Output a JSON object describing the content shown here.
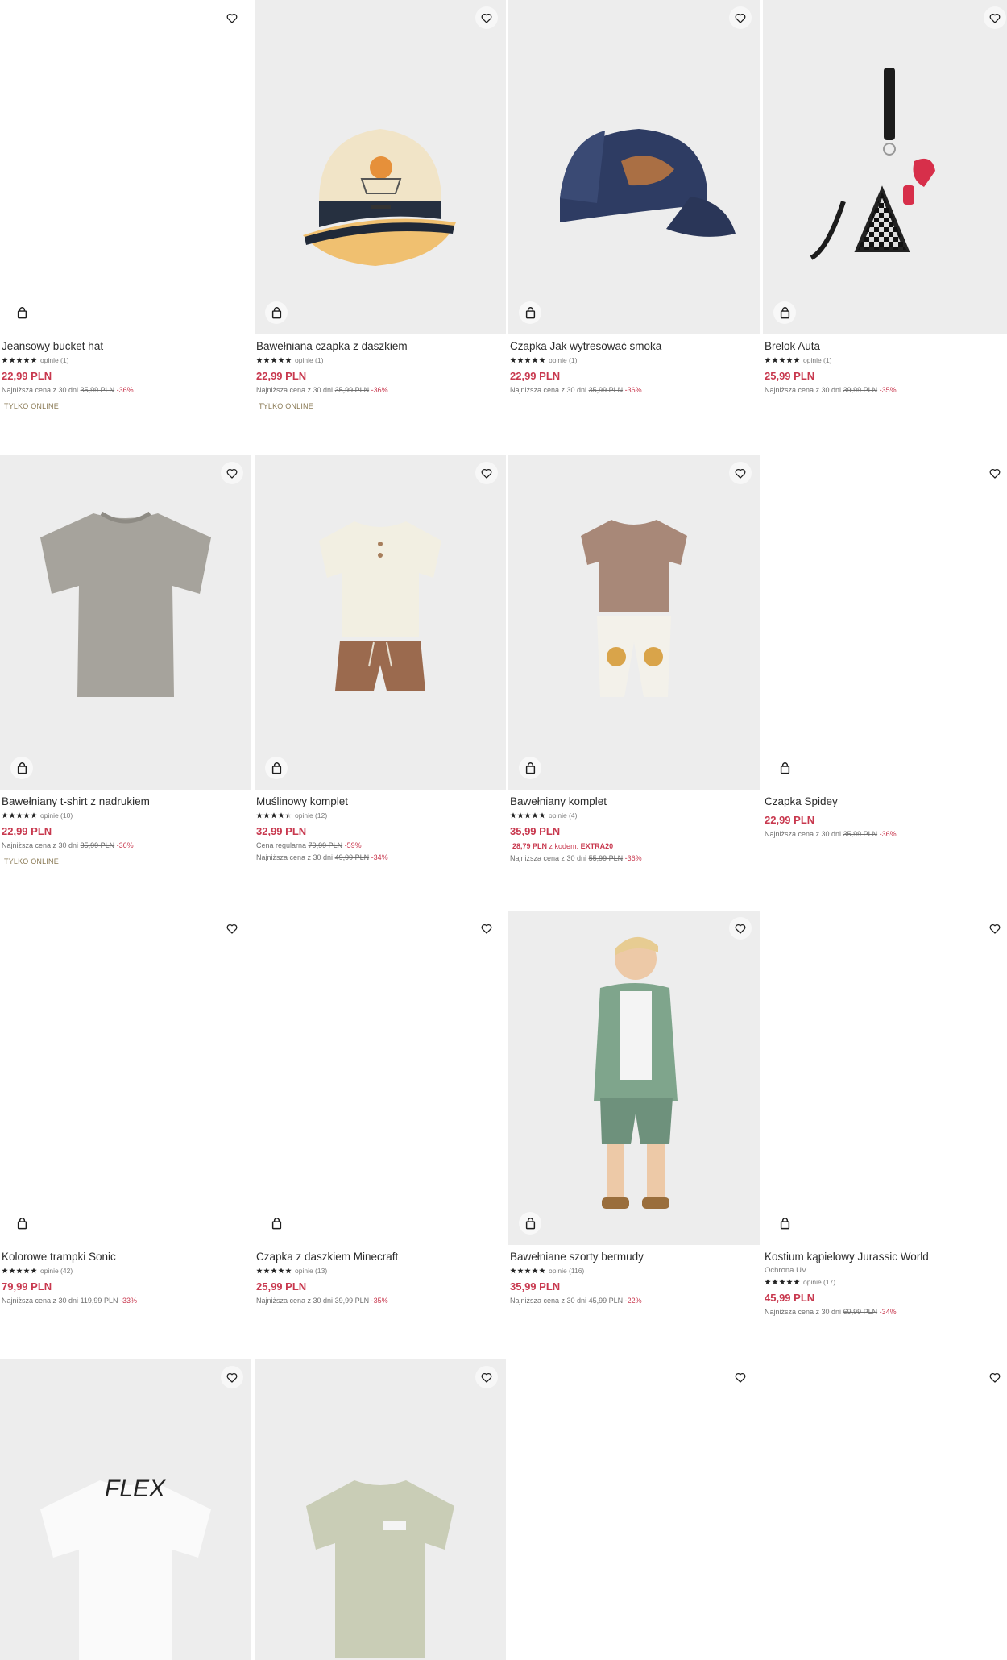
{
  "colors": {
    "price": "#c8384e",
    "tile_bg": "#ededed",
    "online_badge": "#8a7a55"
  },
  "icons": {
    "favorite": "heart-icon",
    "cart": "shopping-bag-icon",
    "rating": "star-icon"
  },
  "products": [
    {
      "name": "Jeansowy bucket hat",
      "reviews": "opinie (1)",
      "price": "22,99 PLN",
      "lowest_label": "Najniższa cena z 30 dni",
      "lowest_old": "35,99 PLN",
      "lowest_disc": "-36%",
      "badge": "TYLKO ONLINE",
      "rating": 5
    },
    {
      "name": "Bawełniana czapka z daszkiem",
      "reviews": "opinie (1)",
      "price": "22,99 PLN",
      "lowest_label": "Najniższa cena z 30 dni",
      "lowest_old": "35,99 PLN",
      "lowest_disc": "-36%",
      "badge": "TYLKO ONLINE",
      "rating": 5
    },
    {
      "name": "Czapka Jak wytresować smoka",
      "reviews": "opinie (1)",
      "price": "22,99 PLN",
      "lowest_label": "Najniższa cena z 30 dni",
      "lowest_old": "35,99 PLN",
      "lowest_disc": "-36%",
      "rating": 5
    },
    {
      "name": "Brelok Auta",
      "reviews": "opinie (1)",
      "price": "25,99 PLN",
      "lowest_label": "Najniższa cena z 30 dni",
      "lowest_old": "39,99 PLN",
      "lowest_disc": "-35%",
      "rating": 5
    },
    {
      "name": "Bawełniany t-shirt z nadrukiem",
      "reviews": "opinie (10)",
      "price": "22,99 PLN",
      "lowest_label": "Najniższa cena z 30 dni",
      "lowest_old": "35,99 PLN",
      "lowest_disc": "-36%",
      "badge": "TYLKO ONLINE",
      "rating": 5
    },
    {
      "name": "Muślinowy komplet",
      "reviews": "opinie (12)",
      "price": "32,99 PLN",
      "regular_label": "Cena regularna",
      "regular_old": "79,99 PLN",
      "regular_disc": "-59%",
      "lowest_label": "Najniższa cena z 30 dni",
      "lowest_old": "49,99 PLN",
      "lowest_disc": "-34%",
      "rating": 4.5
    },
    {
      "name": "Bawełniany komplet",
      "reviews": "opinie (4)",
      "price": "35,99 PLN",
      "promo_price": "28,79 PLN",
      "promo_text": "z kodem:",
      "promo_code": "EXTRA20",
      "lowest_label": "Najniższa cena z 30 dni",
      "lowest_old": "55,99 PLN",
      "lowest_disc": "-36%",
      "rating": 5
    },
    {
      "name": "Czapka Spidey",
      "price": "22,99 PLN",
      "lowest_label": "Najniższa cena z 30 dni",
      "lowest_old": "35,99 PLN",
      "lowest_disc": "-36%"
    },
    {
      "name": "Kolorowe trampki Sonic",
      "reviews": "opinie (42)",
      "price": "79,99 PLN",
      "lowest_label": "Najniższa cena z 30 dni",
      "lowest_old": "119,99 PLN",
      "lowest_disc": "-33%",
      "rating": 5
    },
    {
      "name": "Czapka z daszkiem Minecraft",
      "reviews": "opinie (13)",
      "price": "25,99 PLN",
      "lowest_label": "Najniższa cena z 30 dni",
      "lowest_old": "39,99 PLN",
      "lowest_disc": "-35%",
      "rating": 5
    },
    {
      "name": "Bawełniane szorty bermudy",
      "reviews": "opinie (116)",
      "price": "35,99 PLN",
      "lowest_label": "Najniższa cena z 30 dni",
      "lowest_old": "45,99 PLN",
      "lowest_disc": "-22%",
      "rating": 5
    },
    {
      "name": "Kostium kąpielowy Jurassic World",
      "subtitle": "Ochrona UV",
      "reviews": "opinie (17)",
      "price": "45,99 PLN",
      "lowest_label": "Najniższa cena z 30 dni",
      "lowest_old": "69,99 PLN",
      "lowest_disc": "-34%",
      "rating": 5
    },
    {
      "name": "",
      "price": ""
    },
    {
      "name": "",
      "price": ""
    },
    {
      "name": "",
      "price": ""
    },
    {
      "name": "",
      "price": ""
    }
  ]
}
